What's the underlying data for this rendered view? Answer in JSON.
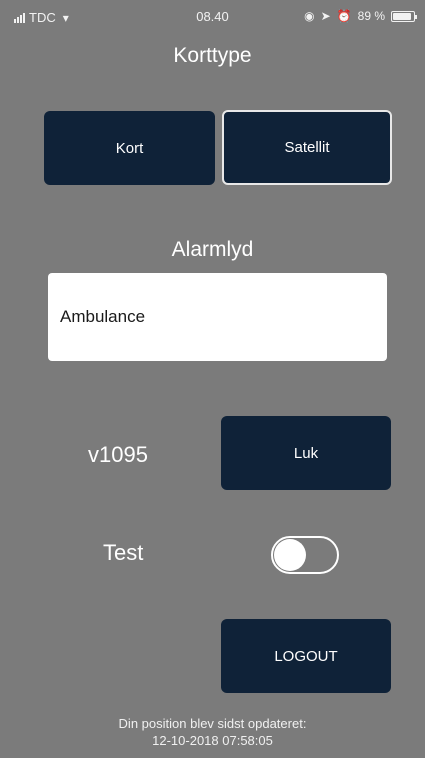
{
  "status_bar": {
    "carrier": "TDC",
    "time": "08.40",
    "battery_percent": "89 %",
    "battery_level": 0.89
  },
  "title": "Korttype",
  "map_type": {
    "options": [
      "Kort",
      "Satellit"
    ],
    "selected": "Satellit"
  },
  "alarm": {
    "label": "Alarmlyd",
    "value": "Ambulance"
  },
  "version": "v1095",
  "close_label": "Luk",
  "test": {
    "label": "Test",
    "enabled": false
  },
  "logout_label": "LOGOUT",
  "footer": {
    "line1": "Din position blev sidst opdateret:",
    "line2": "12-10-2018 07:58:05"
  },
  "colors": {
    "background": "#7b7b7b",
    "button": "#0f2238"
  }
}
